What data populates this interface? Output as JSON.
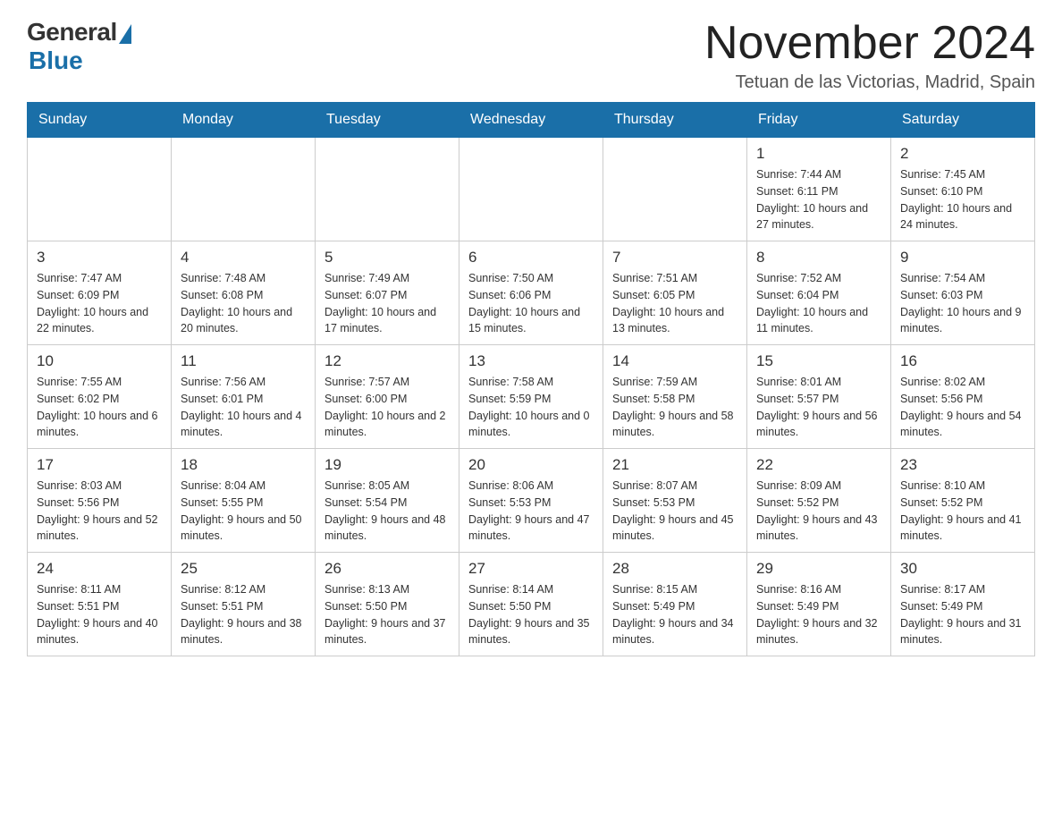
{
  "header": {
    "logo_general": "General",
    "logo_blue": "Blue",
    "title": "November 2024",
    "subtitle": "Tetuan de las Victorias, Madrid, Spain"
  },
  "days_of_week": [
    "Sunday",
    "Monday",
    "Tuesday",
    "Wednesday",
    "Thursday",
    "Friday",
    "Saturday"
  ],
  "weeks": [
    [
      {
        "day": "",
        "info": ""
      },
      {
        "day": "",
        "info": ""
      },
      {
        "day": "",
        "info": ""
      },
      {
        "day": "",
        "info": ""
      },
      {
        "day": "",
        "info": ""
      },
      {
        "day": "1",
        "info": "Sunrise: 7:44 AM\nSunset: 6:11 PM\nDaylight: 10 hours and 27 minutes."
      },
      {
        "day": "2",
        "info": "Sunrise: 7:45 AM\nSunset: 6:10 PM\nDaylight: 10 hours and 24 minutes."
      }
    ],
    [
      {
        "day": "3",
        "info": "Sunrise: 7:47 AM\nSunset: 6:09 PM\nDaylight: 10 hours and 22 minutes."
      },
      {
        "day": "4",
        "info": "Sunrise: 7:48 AM\nSunset: 6:08 PM\nDaylight: 10 hours and 20 minutes."
      },
      {
        "day": "5",
        "info": "Sunrise: 7:49 AM\nSunset: 6:07 PM\nDaylight: 10 hours and 17 minutes."
      },
      {
        "day": "6",
        "info": "Sunrise: 7:50 AM\nSunset: 6:06 PM\nDaylight: 10 hours and 15 minutes."
      },
      {
        "day": "7",
        "info": "Sunrise: 7:51 AM\nSunset: 6:05 PM\nDaylight: 10 hours and 13 minutes."
      },
      {
        "day": "8",
        "info": "Sunrise: 7:52 AM\nSunset: 6:04 PM\nDaylight: 10 hours and 11 minutes."
      },
      {
        "day": "9",
        "info": "Sunrise: 7:54 AM\nSunset: 6:03 PM\nDaylight: 10 hours and 9 minutes."
      }
    ],
    [
      {
        "day": "10",
        "info": "Sunrise: 7:55 AM\nSunset: 6:02 PM\nDaylight: 10 hours and 6 minutes."
      },
      {
        "day": "11",
        "info": "Sunrise: 7:56 AM\nSunset: 6:01 PM\nDaylight: 10 hours and 4 minutes."
      },
      {
        "day": "12",
        "info": "Sunrise: 7:57 AM\nSunset: 6:00 PM\nDaylight: 10 hours and 2 minutes."
      },
      {
        "day": "13",
        "info": "Sunrise: 7:58 AM\nSunset: 5:59 PM\nDaylight: 10 hours and 0 minutes."
      },
      {
        "day": "14",
        "info": "Sunrise: 7:59 AM\nSunset: 5:58 PM\nDaylight: 9 hours and 58 minutes."
      },
      {
        "day": "15",
        "info": "Sunrise: 8:01 AM\nSunset: 5:57 PM\nDaylight: 9 hours and 56 minutes."
      },
      {
        "day": "16",
        "info": "Sunrise: 8:02 AM\nSunset: 5:56 PM\nDaylight: 9 hours and 54 minutes."
      }
    ],
    [
      {
        "day": "17",
        "info": "Sunrise: 8:03 AM\nSunset: 5:56 PM\nDaylight: 9 hours and 52 minutes."
      },
      {
        "day": "18",
        "info": "Sunrise: 8:04 AM\nSunset: 5:55 PM\nDaylight: 9 hours and 50 minutes."
      },
      {
        "day": "19",
        "info": "Sunrise: 8:05 AM\nSunset: 5:54 PM\nDaylight: 9 hours and 48 minutes."
      },
      {
        "day": "20",
        "info": "Sunrise: 8:06 AM\nSunset: 5:53 PM\nDaylight: 9 hours and 47 minutes."
      },
      {
        "day": "21",
        "info": "Sunrise: 8:07 AM\nSunset: 5:53 PM\nDaylight: 9 hours and 45 minutes."
      },
      {
        "day": "22",
        "info": "Sunrise: 8:09 AM\nSunset: 5:52 PM\nDaylight: 9 hours and 43 minutes."
      },
      {
        "day": "23",
        "info": "Sunrise: 8:10 AM\nSunset: 5:52 PM\nDaylight: 9 hours and 41 minutes."
      }
    ],
    [
      {
        "day": "24",
        "info": "Sunrise: 8:11 AM\nSunset: 5:51 PM\nDaylight: 9 hours and 40 minutes."
      },
      {
        "day": "25",
        "info": "Sunrise: 8:12 AM\nSunset: 5:51 PM\nDaylight: 9 hours and 38 minutes."
      },
      {
        "day": "26",
        "info": "Sunrise: 8:13 AM\nSunset: 5:50 PM\nDaylight: 9 hours and 37 minutes."
      },
      {
        "day": "27",
        "info": "Sunrise: 8:14 AM\nSunset: 5:50 PM\nDaylight: 9 hours and 35 minutes."
      },
      {
        "day": "28",
        "info": "Sunrise: 8:15 AM\nSunset: 5:49 PM\nDaylight: 9 hours and 34 minutes."
      },
      {
        "day": "29",
        "info": "Sunrise: 8:16 AM\nSunset: 5:49 PM\nDaylight: 9 hours and 32 minutes."
      },
      {
        "day": "30",
        "info": "Sunrise: 8:17 AM\nSunset: 5:49 PM\nDaylight: 9 hours and 31 minutes."
      }
    ]
  ]
}
